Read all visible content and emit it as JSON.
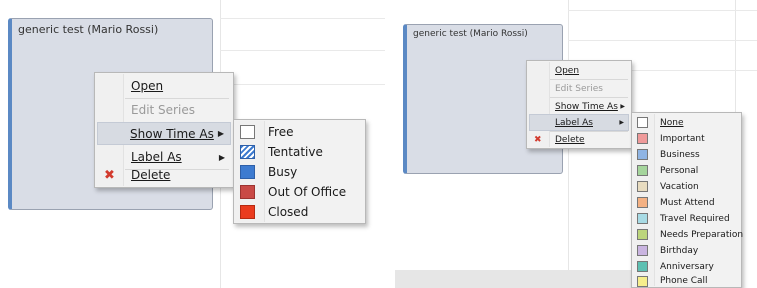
{
  "left": {
    "appointment_title": "generic test (Mario Rossi)",
    "context_menu": [
      {
        "label": "Open",
        "mnemonic": "O"
      },
      {
        "label": "Edit Series",
        "disabled": true
      },
      {
        "label": "Show Time As",
        "mnemonic": "S",
        "submenu": true,
        "highlighted": true
      },
      {
        "label": "Label As",
        "mnemonic": "L",
        "submenu": true
      },
      {
        "label": "Delete",
        "mnemonic": "D",
        "icon": "delete-x-icon"
      }
    ],
    "show_time_as_submenu": [
      {
        "label": "Free",
        "mnemonic": "F",
        "color": "#ffffff"
      },
      {
        "label": "Tentative",
        "mnemonic": "T",
        "color": "#3d7bd0",
        "pattern": "hatched"
      },
      {
        "label": "Busy",
        "mnemonic": "B",
        "color": "#3d7bd0"
      },
      {
        "label": "Out Of Office",
        "mnemonic": "O",
        "color": "#c94a46"
      },
      {
        "label": "Closed",
        "mnemonic": "C",
        "color": "#ea3b1e"
      }
    ]
  },
  "right": {
    "appointment_title": "generic test (Mario Rossi)",
    "context_menu": [
      {
        "label": "Open",
        "mnemonic": "O"
      },
      {
        "label": "Edit Series",
        "disabled": true
      },
      {
        "label": "Show Time As",
        "mnemonic": "S",
        "submenu": true
      },
      {
        "label": "Label As",
        "mnemonic": "L",
        "submenu": true,
        "highlighted": true
      },
      {
        "label": "Delete",
        "mnemonic": "D",
        "icon": "delete-x-icon"
      }
    ],
    "label_as_submenu": [
      {
        "label": "None",
        "mnemonic": "N",
        "color": "#ffffff"
      },
      {
        "label": "Important",
        "mnemonic": "I",
        "color": "#ef9a9a"
      },
      {
        "label": "Business",
        "mnemonic": "B",
        "color": "#8fb4e3"
      },
      {
        "label": "Personal",
        "mnemonic": "P",
        "color": "#a5d59c"
      },
      {
        "label": "Vacation",
        "mnemonic": "V",
        "color": "#e8dcc0"
      },
      {
        "label": "Must Attend",
        "mnemonic": "A",
        "color": "#f4b183"
      },
      {
        "label": "Travel Required",
        "mnemonic": "T",
        "color": "#a8dbe5"
      },
      {
        "label": "Needs Preparation",
        "mnemonic": "N",
        "color": "#bcd57c"
      },
      {
        "label": "Birthday",
        "mnemonic": "B",
        "color": "#c9b4e0"
      },
      {
        "label": "Anniversary",
        "mnemonic": "A",
        "color": "#5dc0b2"
      },
      {
        "label": "Phone Call",
        "mnemonic": "C",
        "color": "#f6ee8c"
      }
    ]
  }
}
